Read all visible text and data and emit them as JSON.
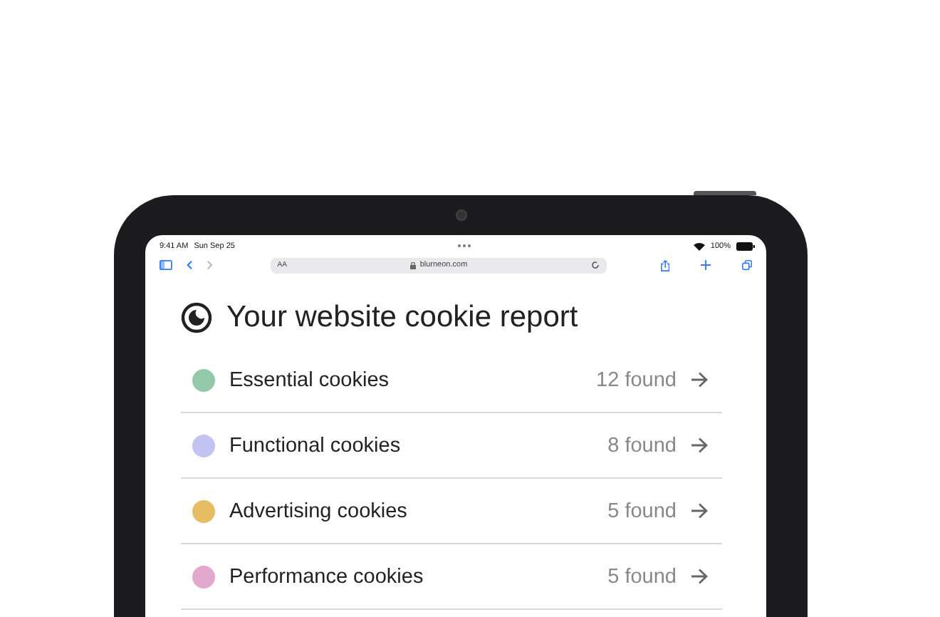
{
  "status_bar": {
    "time": "9:41 AM",
    "date": "Sun Sep 25",
    "battery": "100%"
  },
  "browser": {
    "text_size": "AA",
    "url": "blurneon.com"
  },
  "report": {
    "title": "Your website cookie report",
    "categories": [
      {
        "name": "Essential cookies",
        "count": "12 found",
        "color": "#93c9a9"
      },
      {
        "name": "Functional cookies",
        "count": "8 found",
        "color": "#c3c3f2"
      },
      {
        "name": "Advertising cookies",
        "count": "5 found",
        "color": "#e6bd62"
      },
      {
        "name": "Performance cookies",
        "count": "5 found",
        "color": "#e3a9cc"
      }
    ]
  }
}
